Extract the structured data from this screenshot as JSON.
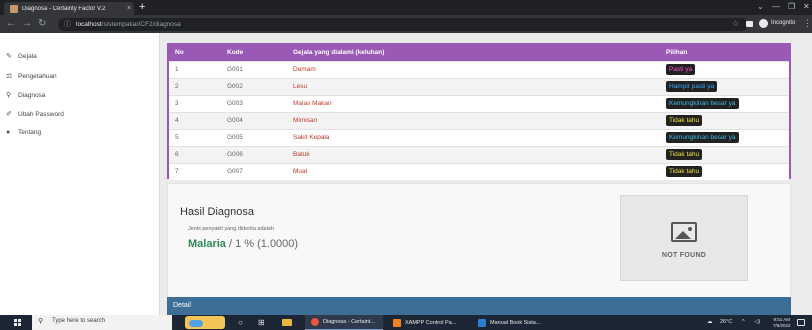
{
  "browser": {
    "tab_title": "Diagnosa - Certainty Factor V.2",
    "tab_close": "×",
    "new_tab": "+",
    "url_host": "localhost",
    "url_path": "/sistempakar/CF2/diagnosa",
    "incognito_label": "Incognito",
    "win_minimize": "—",
    "win_restore": "❐",
    "win_close": "✕"
  },
  "sidebar": {
    "items": [
      {
        "label": "Gejala",
        "icon": "wrench-icon"
      },
      {
        "label": "Pengetahuan",
        "icon": "balance-scale-icon"
      },
      {
        "label": "Diagnosa",
        "icon": "search-icon"
      },
      {
        "label": "Ubah Password",
        "icon": "edit-icon"
      },
      {
        "label": "Tentang",
        "icon": "info-icon"
      }
    ]
  },
  "table": {
    "headers": {
      "no": "No",
      "kode": "Kode",
      "gejala": "Gejala yang dialami (keluhan)",
      "pilihan": "Pilihan"
    },
    "rows": [
      {
        "no": "1",
        "kode": "G001",
        "gejala": "Demam",
        "pilihan": "Pasti ya",
        "color": "#ff4fd8"
      },
      {
        "no": "2",
        "kode": "G002",
        "gejala": "Lesu",
        "pilihan": "Hampir pasti ya",
        "color": "#38a8ff"
      },
      {
        "no": "3",
        "kode": "G003",
        "gejala": "Malas Makan",
        "pilihan": "Kemungkinan besar ya",
        "color": "#3db8e8"
      },
      {
        "no": "4",
        "kode": "G004",
        "gejala": "Mimisan",
        "pilihan": "Tidak tahu",
        "color": "#f0e23c"
      },
      {
        "no": "5",
        "kode": "G005",
        "gejala": "Sakit Kepala",
        "pilihan": "Kemungkinan besar ya",
        "color": "#3db8e8"
      },
      {
        "no": "6",
        "kode": "G006",
        "gejala": "Batuk",
        "pilihan": "Tidak tahu",
        "color": "#f0e23c"
      },
      {
        "no": "7",
        "kode": "G007",
        "gejala": "Mual",
        "pilihan": "Tidak tahu",
        "color": "#f0e23c"
      }
    ]
  },
  "result": {
    "title": "Hasil Diagnosa",
    "subtitle": "Jenis penyakit yang diderita adalah",
    "disease": "Malaria",
    "value": " / 1 % (1.0000)",
    "image_placeholder": "NOT FOUND"
  },
  "detail": {
    "label": "Detail"
  },
  "colors": {
    "accent_purple": "#9b59b6",
    "detail_blue": "#3c6e96",
    "disease_green": "#2e8b57"
  },
  "taskbar": {
    "search_placeholder": "Type here to search",
    "apps": [
      {
        "label": "Diagnosa - Certaint...",
        "color": "#e9553f"
      },
      {
        "label": "XAMPP Control Pa...",
        "color": "#f58220"
      },
      {
        "label": "Manual Book Sista...",
        "color": "#2b7cd3"
      }
    ],
    "weather": "26°C",
    "time": "9:51 AM",
    "date": "7/6/2022"
  }
}
